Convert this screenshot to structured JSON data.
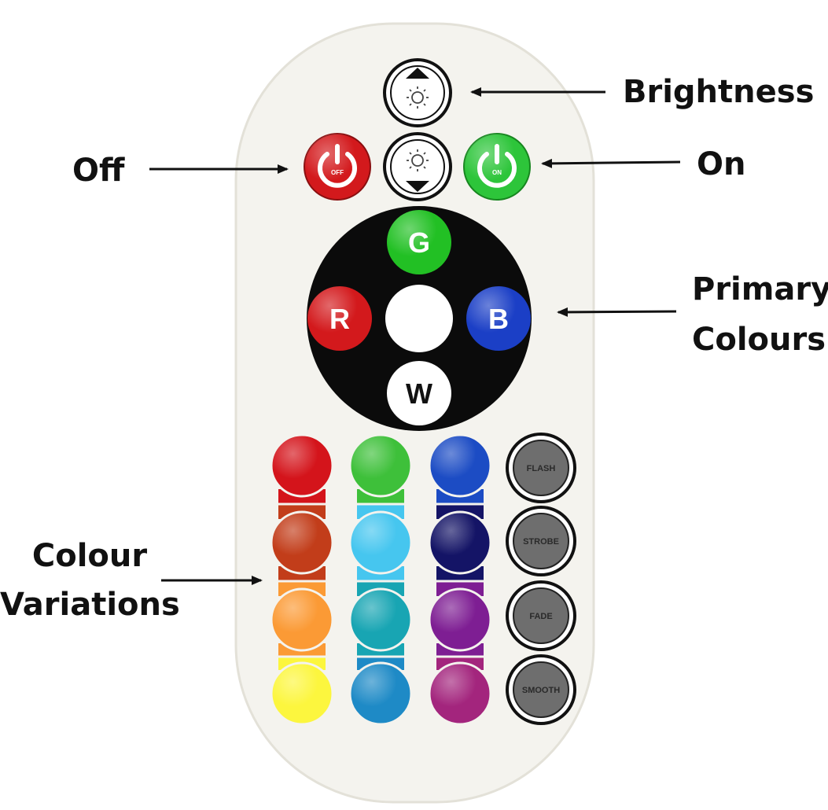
{
  "labels": {
    "brightness": "Brightness",
    "off": "Off",
    "on": "On",
    "primary_line1": "Primary",
    "primary_line2": "Colours",
    "variations_line1": "Colour",
    "variations_line2": "Variations"
  },
  "remote": {
    "power_off_text": "OFF",
    "power_on_text": "ON",
    "primary_buttons": [
      {
        "letter": "G",
        "color": "#22c024"
      },
      {
        "letter": "R",
        "color": "#d3191c"
      },
      {
        "letter": "B",
        "color": "#1b3fc6"
      },
      {
        "letter": "W",
        "color": "#ffffff"
      }
    ],
    "mode_buttons": [
      "FLASH",
      "STROBE",
      "FADE",
      "SMOOTH"
    ],
    "colour_columns": [
      [
        "#d4141b",
        "#c23d1a",
        "#fb9a35",
        "#fcf63e"
      ],
      [
        "#3ec03a",
        "#46c6ef",
        "#18a5b3",
        "#1e8ac6"
      ],
      [
        "#1c4cc4",
        "#141466",
        "#7e1e93",
        "#a3257d"
      ]
    ],
    "accent_colors": {
      "off": "#d3191c",
      "on": "#2dc53a",
      "body": "#f4f3ee",
      "ring": "#0b0b0b"
    }
  }
}
